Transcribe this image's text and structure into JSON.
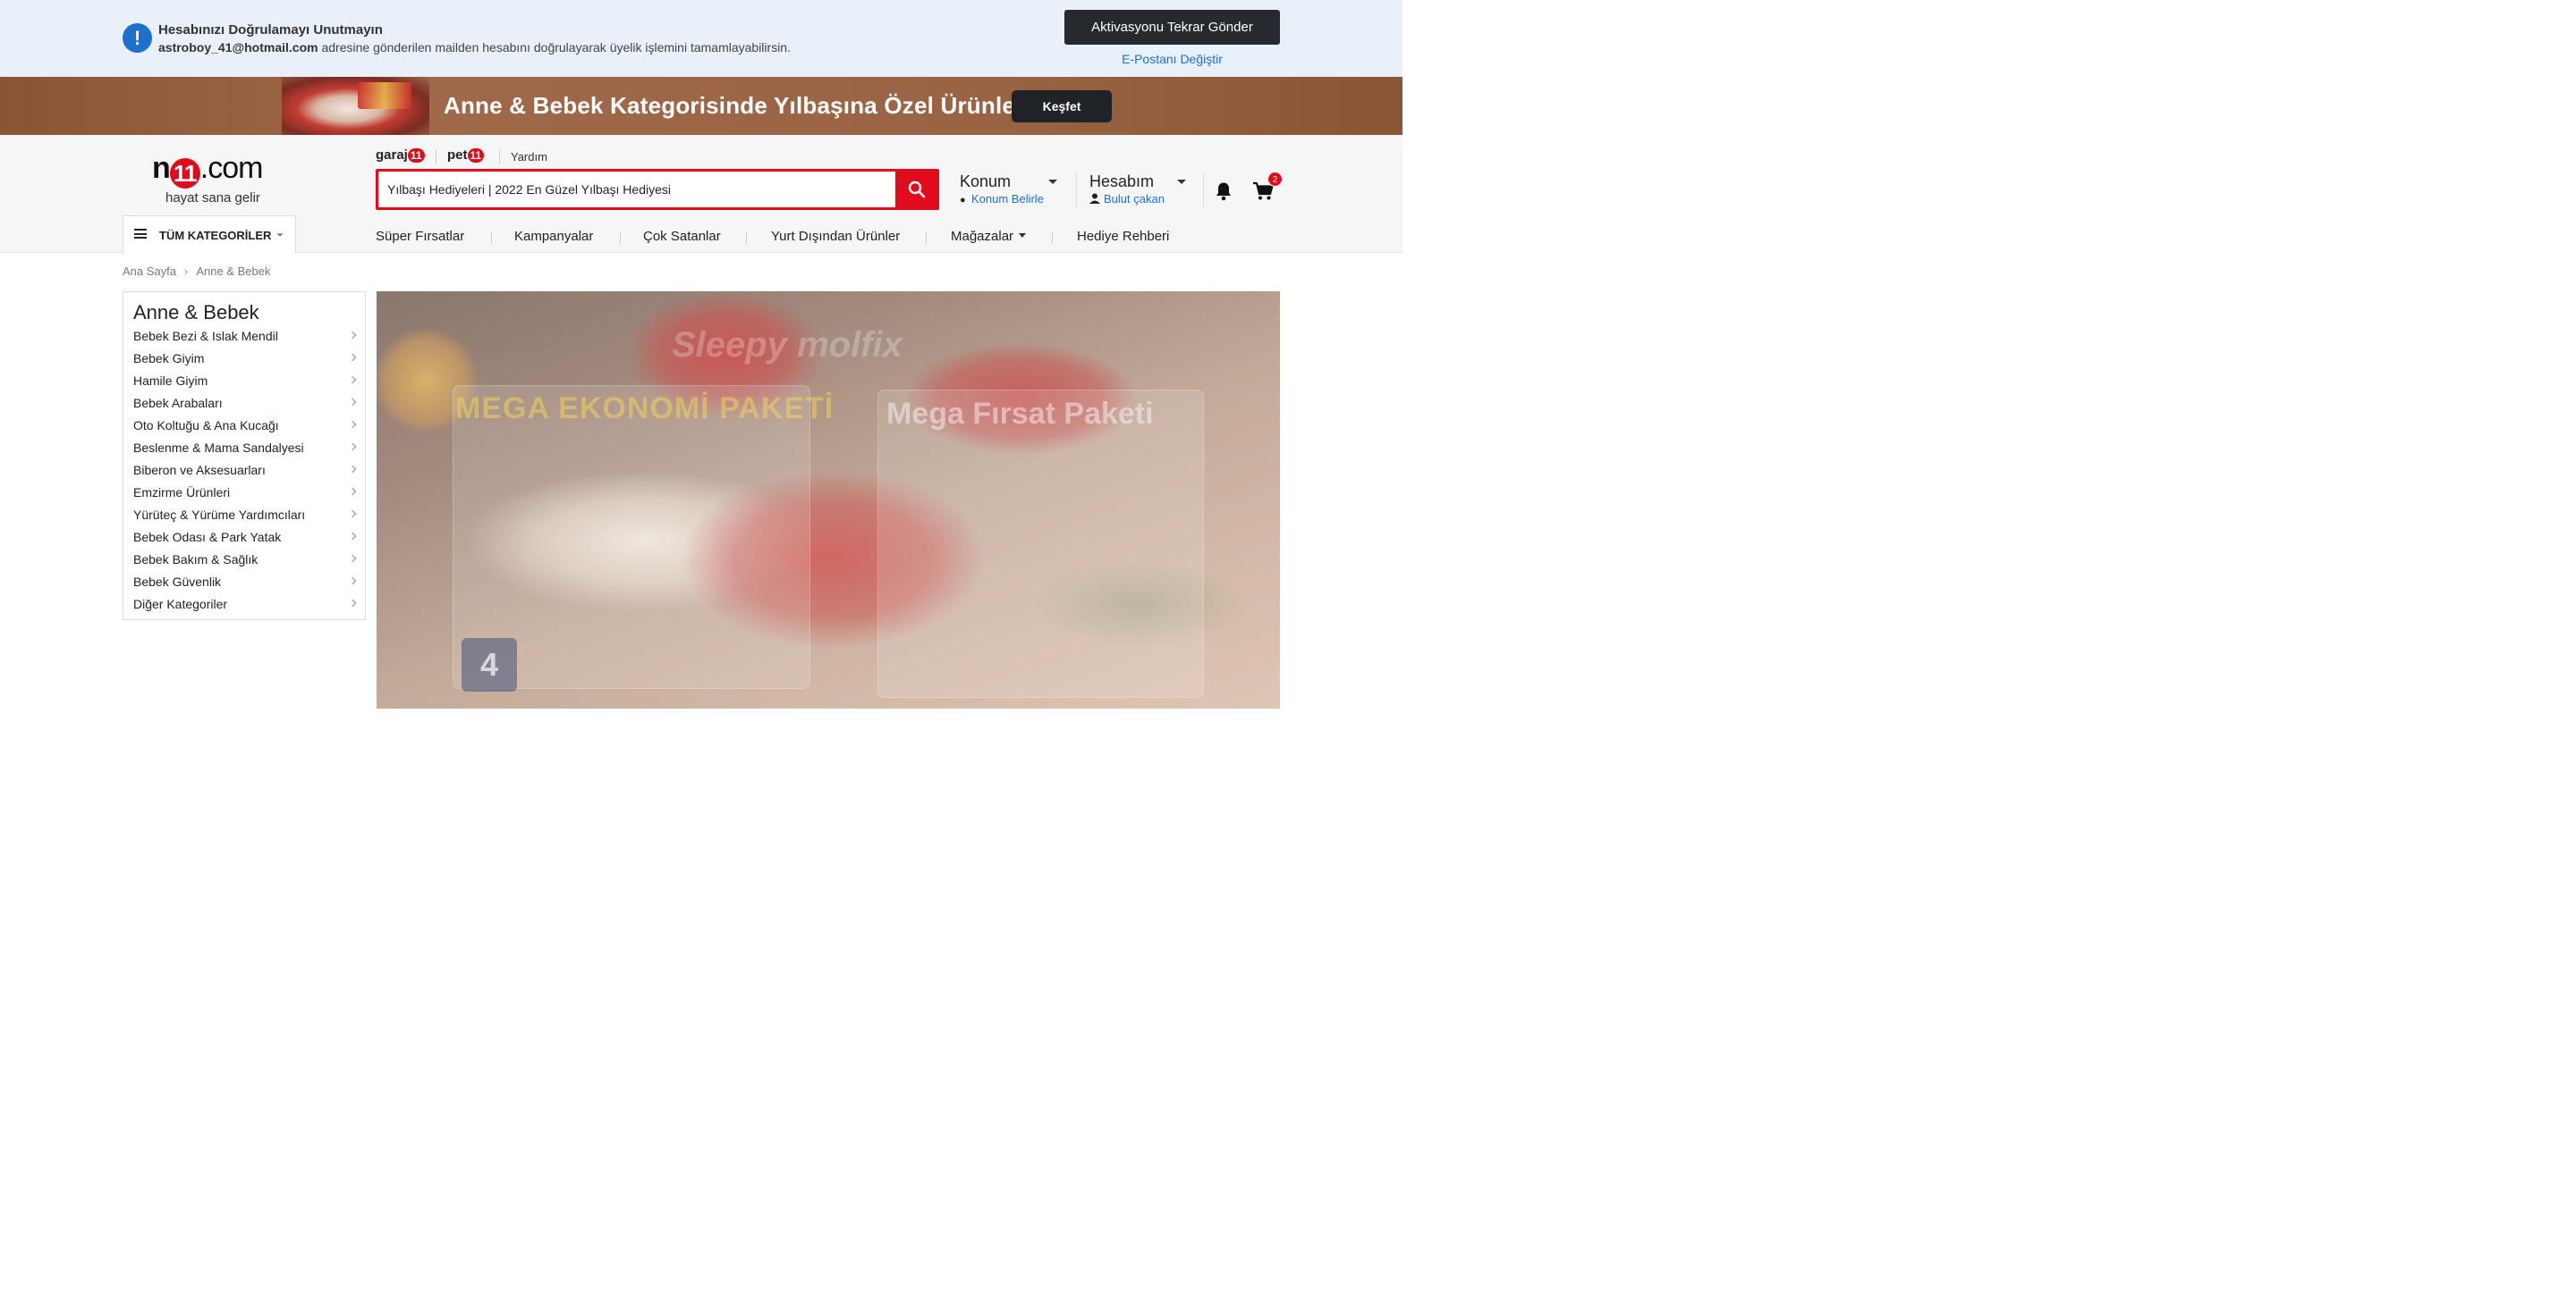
{
  "verify_bar": {
    "title": "Hesabınızı Doğrulamayı Unutmayın",
    "email": "astroboy_41@hotmail.com",
    "message": "adresine gönderilen mailden hesabını doğrulayarak üyelik işlemini tamamlayabilirsin.",
    "resend_label": "Aktivasyonu Tekrar Gönder",
    "change_email_label": "E-Postanı Değiştir",
    "icon": "exclamation-icon"
  },
  "promo": {
    "text": "Anne & Bebek Kategorisinde Yılbaşına Özel Ürünler",
    "button_label": "Keşfet"
  },
  "header": {
    "logo_prefix": "n",
    "logo_badge": "11",
    "logo_suffix": ".com",
    "tagline": "hayat sana gelir",
    "sublinks": {
      "garaj_text": "garaj",
      "garaj_badge": "11",
      "pet_text": "pet",
      "pet_badge": "11",
      "help": "Yardım"
    },
    "search_value": "Yılbaşı Hediyeleri | 2022 En Güzel Yılbaşı Hediyesi",
    "location": {
      "title": "Konum",
      "subtitle": "Konum Belirle"
    },
    "account": {
      "title": "Hesabım",
      "subtitle": "Bulut çakan"
    },
    "cart_count": "2",
    "all_categories": "TÜM KATEGORİLER",
    "nav": [
      {
        "label": "Süper Fırsatlar"
      },
      {
        "label": "Kampanyalar"
      },
      {
        "label": "Çok Satanlar"
      },
      {
        "label": "Yurt Dışından Ürünler"
      },
      {
        "label": "Mağazalar"
      },
      {
        "label": "Hediye Rehberi"
      }
    ]
  },
  "breadcrumb": [
    "Ana Sayfa",
    "Anne & Bebek"
  ],
  "category_panel": {
    "title": "Anne & Bebek",
    "items": [
      {
        "label": "Bebek Bezi & Islak Mendil"
      },
      {
        "label": "Bebek Giyim"
      },
      {
        "label": "Hamile Giyim"
      },
      {
        "label": "Bebek Arabaları"
      },
      {
        "label": "Oto Koltuğu & Ana Kucağı"
      },
      {
        "label": "Beslenme & Mama Sandalyesi"
      },
      {
        "label": "Biberon ve Aksesuarları"
      },
      {
        "label": "Emzirme Ürünleri"
      },
      {
        "label": "Yürüteç & Yürüme Yardımcıları"
      },
      {
        "label": "Bebek Odası & Park Yatak"
      },
      {
        "label": "Bebek Bakım & Sağlık"
      },
      {
        "label": "Bebek Güvenlik"
      },
      {
        "label": "Diğer Kategoriler"
      }
    ]
  },
  "hero": {
    "text_left": "MEGA EKONOMİ PAKETİ",
    "text_right": "Mega Fırsat Paketi",
    "text_top": "Sleepy molfix",
    "size_badge": "4"
  },
  "colors": {
    "brand_red": "#e20b1b",
    "link_blue": "#1d6fd0",
    "verify_bg": "#e8f0f9",
    "promo_bg": "#9a6444"
  }
}
